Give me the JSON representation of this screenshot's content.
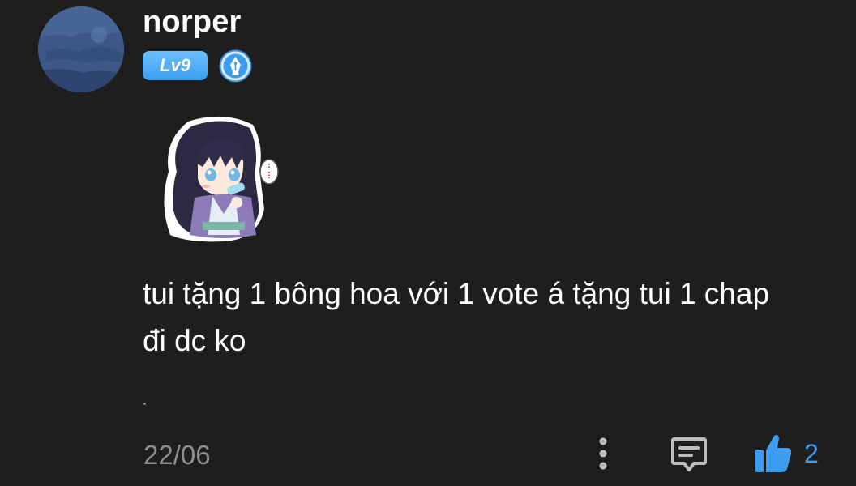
{
  "comment": {
    "username": "norper",
    "level": "Lv9",
    "badge_icon": "fountain-pen-icon",
    "text": "tui tặng 1 bông hoa với 1 vote á tặng tui 1 chap đi dc ko",
    "date": "22/06",
    "likes": "2"
  },
  "actions": {
    "more_icon": "more-vertical-icon",
    "reply_icon": "comment-reply-icon",
    "like_icon": "thumbs-up-icon"
  },
  "colors": {
    "background": "#1e1e1f",
    "accent": "#3d9cf0",
    "muted": "#8e8e8e"
  }
}
